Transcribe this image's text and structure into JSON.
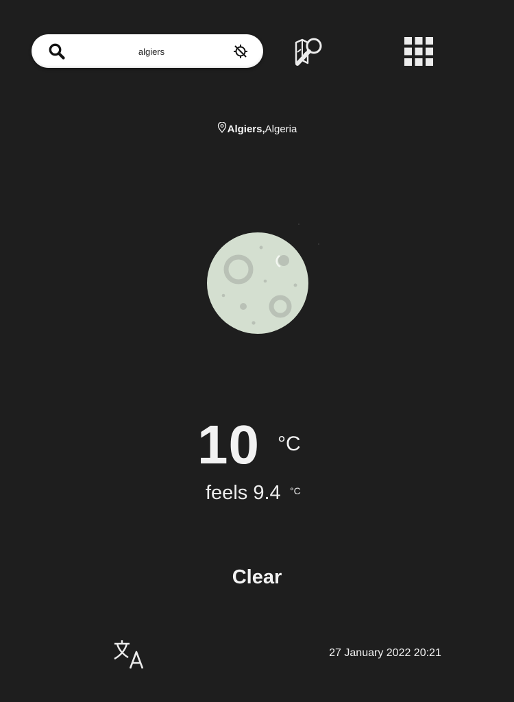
{
  "search": {
    "value": "algiers",
    "placeholder": ""
  },
  "icons": {
    "search": "search-icon",
    "locate": "locate-off-icon",
    "map_search": "map-search-icon",
    "apps": "apps-grid-icon",
    "location_pin": "map-pin-icon",
    "weather": "full-moon-icon",
    "translate": "translate-icon"
  },
  "location": {
    "city": "Algiers,",
    "country": "Algeria"
  },
  "weather": {
    "temperature": "10",
    "temperature_unit": "°C",
    "feels_like": "feels 9.4",
    "feels_unit": "°C",
    "condition": "Clear"
  },
  "footer": {
    "datetime": "27 January 2022 20:21"
  },
  "colors": {
    "background": "#1e1e1e",
    "moon": "#d4dfd0",
    "crater": "#b9c1b6",
    "text": "#f2f2f2"
  }
}
